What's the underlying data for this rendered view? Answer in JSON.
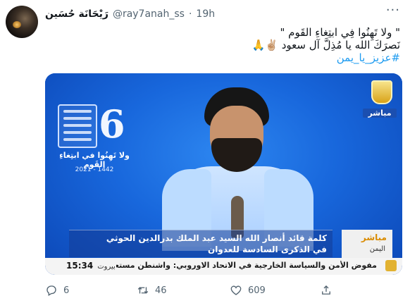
{
  "tweet": {
    "author": {
      "display_name": "رَيْحَانَة حُسَين",
      "handle": "@ray7anah_ss",
      "separator": "·",
      "time": "19h"
    },
    "more_glyph": "···",
    "text": {
      "line1": "\" ولا تَهِنُوا فِي ابتِغاءِ القَوم \"",
      "line2": "نَصرَكَ الله يا مُذِلَّ آل سعود ✌🏼🙏",
      "hashtag": "#عزيز_يا_يمن"
    },
    "media": {
      "anniversary": {
        "number": "6",
        "slogan": "ولا تَهِنُوا في ابتِغاءِ القَوم",
        "years": "2021 - 1442"
      },
      "channel_live": "مباشر",
      "lower_third": {
        "live_label": "مباشر",
        "location": "اليمن",
        "caption_line1": "كلمة قائد أنصار الله السيد عبد الملك بدرالدين الحوثي",
        "caption_line2": "في الذكرى السادسة للعدوان",
        "ticker": "مفوض الأمن والسياسة الخارجية في الاتحاد الاوروبي: واشنطن مستعدة للعودة",
        "clock_time": "15:34",
        "clock_city": "بيروت"
      }
    },
    "actions": {
      "replies": "6",
      "retweets": "46",
      "likes": "609"
    }
  },
  "colors": {
    "link": "#1d9bf0",
    "secondary_text": "#536471",
    "primary_text": "#0f1419"
  }
}
